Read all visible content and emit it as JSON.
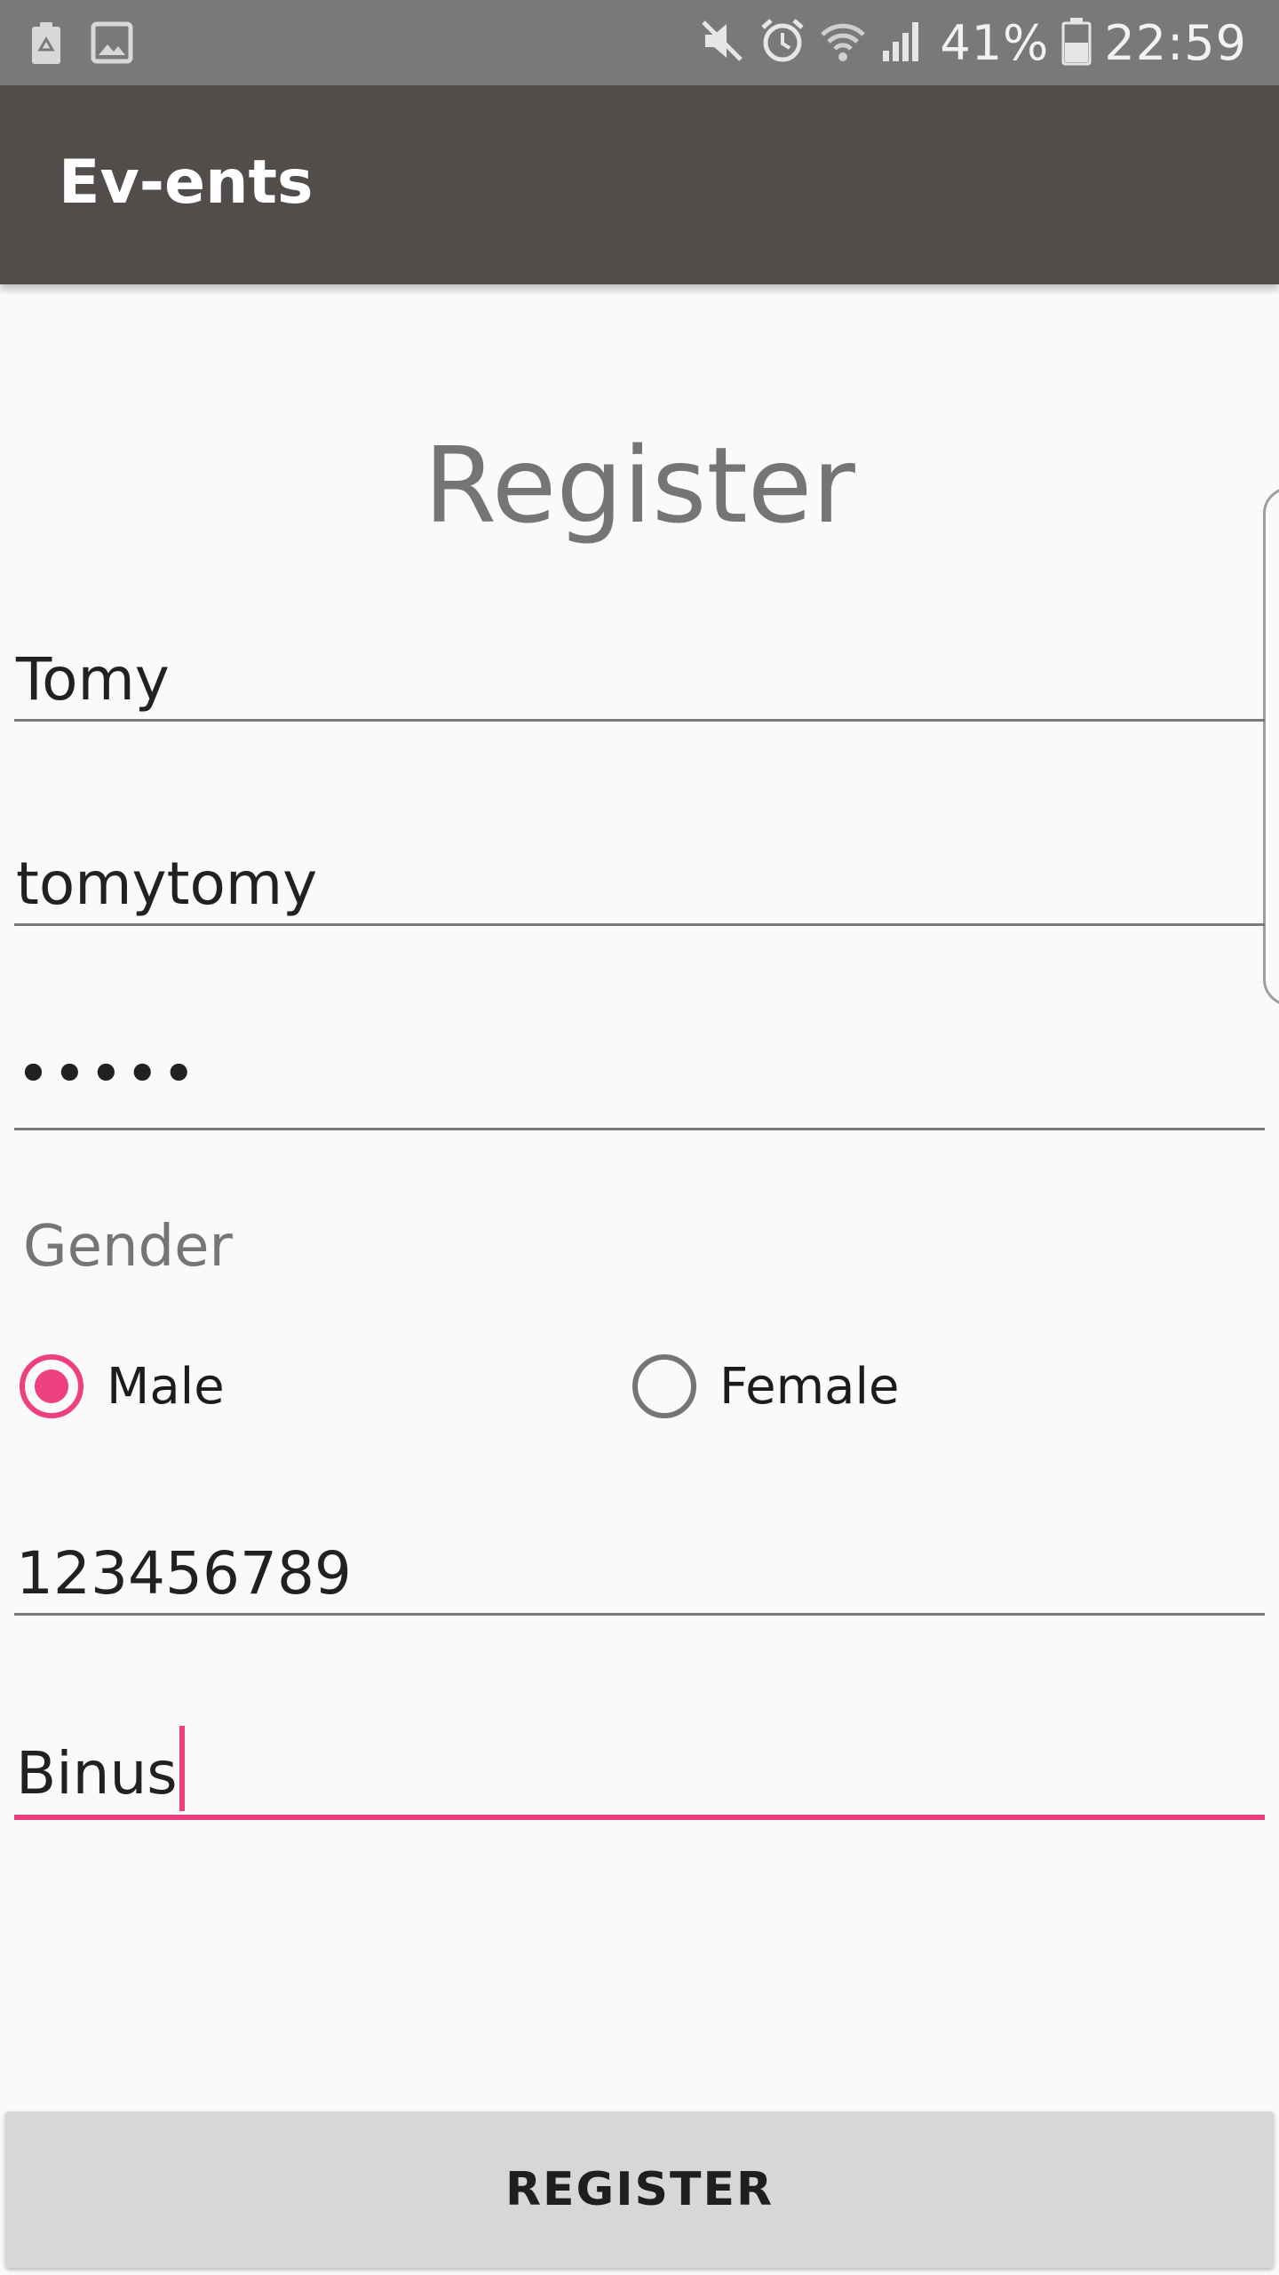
{
  "status_bar": {
    "battery_percent": "41%",
    "time": "22:59",
    "left_icons": [
      "recycle-battery-icon",
      "image-icon"
    ],
    "right_icons": [
      "mute-icon",
      "alarm-icon",
      "wifi-icon",
      "signal-icon",
      "battery-icon"
    ],
    "background": "#797979"
  },
  "app_bar": {
    "title": "Ev-ents",
    "background": "#524c4b"
  },
  "form": {
    "heading": "Register",
    "name_value": "Tomy",
    "username_value": "tomytomy",
    "password_value": "•••••",
    "gender": {
      "label": "Gender",
      "options": [
        {
          "label": "Male",
          "checked": true
        },
        {
          "label": "Female",
          "checked": false
        }
      ]
    },
    "phone_value": "123456789",
    "school_value": "Binus",
    "accent_color": "#ee3f80"
  },
  "register_button": {
    "label": "REGISTER"
  }
}
